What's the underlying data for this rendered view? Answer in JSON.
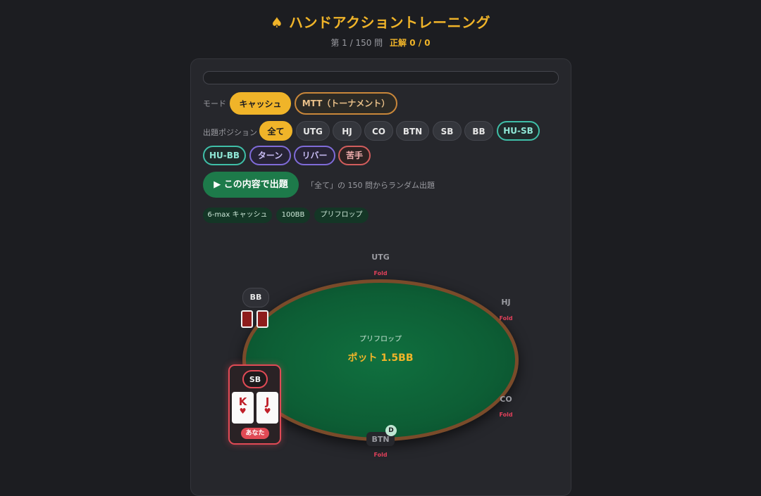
{
  "header": {
    "title": "♠ ハンドアクショントレーニング",
    "progress_text": "第 1 / 150 問",
    "score_text": "正解 0 / 0"
  },
  "progress": {
    "fraction": 0.0
  },
  "mode": {
    "label": "モード",
    "options": [
      "キャッシュ",
      "MTT（トーナメント）"
    ],
    "selected": "キャッシュ"
  },
  "positions": {
    "label": "出題ポジション",
    "options": [
      "全て",
      "UTG",
      "HJ",
      "CO",
      "BTN",
      "SB",
      "BB",
      "HU-SB",
      "HU-BB",
      "ターン",
      "リバー",
      "苦手"
    ],
    "selected": "全て"
  },
  "start": {
    "button_label": "▶ この内容で出題",
    "note": "「全て」の 150 問からランダム出題"
  },
  "tags": [
    "6-max キャッシュ",
    "100BB",
    "プリフロップ"
  ],
  "table": {
    "street": "プリフロップ",
    "pot": "ポット 1.5BB",
    "seats": {
      "utg": {
        "name": "UTG",
        "action": "Fold"
      },
      "hj": {
        "name": "HJ",
        "action": "Fold"
      },
      "co": {
        "name": "CO",
        "action": "Fold"
      },
      "btn": {
        "name": "BTN",
        "action": "Fold",
        "dealer": "D"
      },
      "bb": {
        "name": "BB"
      },
      "sb": {
        "name": "SB",
        "hero_badge": "あなた"
      }
    },
    "hero_cards": [
      {
        "rank": "K",
        "suit": "♥"
      },
      {
        "rank": "J",
        "suit": "♥"
      }
    ]
  },
  "colors": {
    "accent": "#f0b429",
    "felt": "#0d5e35",
    "fold": "#e0405a",
    "hero": "#e04a55"
  }
}
